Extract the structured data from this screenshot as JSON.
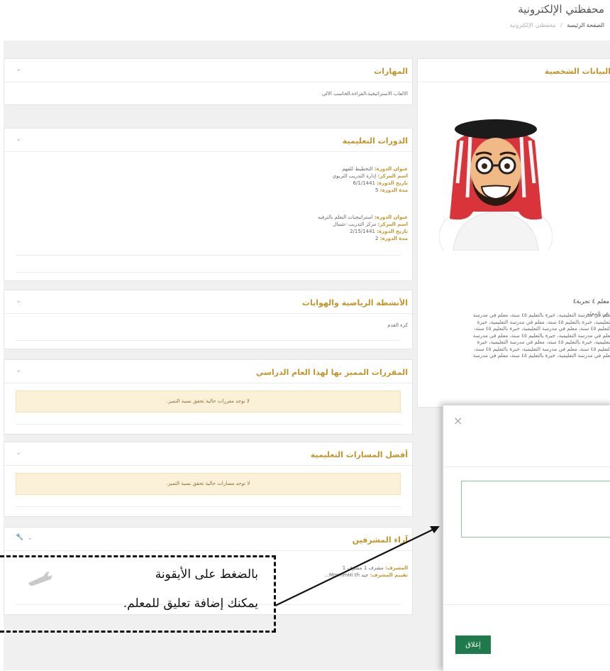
{
  "header": {
    "title": "محفظتي الإلكترونية",
    "breadcrumb_home": "الصفحة الرئيسة",
    "breadcrumb_sep": "/",
    "breadcrumb_current": "محفظتي الإلكترونية"
  },
  "personal": {
    "title": "البيانات الشخصية",
    "teacher_name": "معلم ٤ تجربة٤",
    "about_label": "عن المعلم",
    "about_lines": [
      "معلم في مدرسة التعليمية، خبرة بالتعليم ٤٥ سنة، معلم في مدرسة",
      "التعليمية، خبرة بالتعليم ٤٥ سنة، معلم في مدرسة التعليمية، خبرة",
      "بالتعليم ٤٥ سنة، معلم في مدرسة التعليمية، خبرة بالتعليم ٤٥ سنة،",
      "معلم في مدرسة التعليمية، خبرة بالتعليم ٤٥ سنة، معلم في مدرسة",
      "التعليمية، خبرة بالتعليم ٤٥ سنة، معلم في مدرسة التعليمية، خبرة",
      "بالتعليم ٤٥ سنة، معلم في مدرسة التعليمية، خبرة بالتعليم ٤٥ سنة،",
      "معلم في مدرسة التعليمية، خبرة بالتعليم ٤٥ سنة، معلم في مدرسة"
    ]
  },
  "skills": {
    "title": "المهارات",
    "text": "الالعاب الاستراتيجية،القراءة،الحاسب الالي"
  },
  "courses": {
    "title": "الدورات التعليمية",
    "labels": {
      "title": "عنوان الدورة:",
      "center": "اسم المركز:",
      "date": "تاريخ الدورة:",
      "duration": "مدة الدورة:"
    },
    "items": [
      {
        "title": "التخطيط للفهم",
        "center": "إدارة التدريب التربوي",
        "date": "6/1/1441",
        "duration": "5"
      },
      {
        "title": "استراتيجيات التعلم بالترفيه",
        "center": "مركز التدريب -شمال",
        "date": "2/15/1441",
        "duration": "2"
      }
    ]
  },
  "sports": {
    "title": "الأنشطة الرياضية والهوايات",
    "text": "كرة القدم"
  },
  "excellent_courses": {
    "title": "المقررات المميز بها لهذا العام الدراسي",
    "alert": "لا توجد مقررات حالية تحقق نسبة التميز."
  },
  "best_paths": {
    "title": "أفضل المسارات التعليمية",
    "alert": "لا توجد مسارات حالية تحقق نسبة التميز."
  },
  "supervisors": {
    "title": "آراء المشرفين",
    "label_supervisor": "المشرف:",
    "supervisor_value": "مشرف 1 مشرف 1",
    "label_rating": "تقييم المشرف:",
    "rating_value": "جيد MmmmHi th..."
  },
  "modal": {
    "close_label": "إغلاق",
    "close_symbol": "×"
  },
  "callout": {
    "line1": "بالضغط على الأيقونة",
    "line2": "يمكنك إضافة تعليق للمعلم."
  },
  "colors": {
    "accent": "#c0962b",
    "primary_button": "#1f7a4b",
    "alert_bg": "#fbf1d9"
  }
}
